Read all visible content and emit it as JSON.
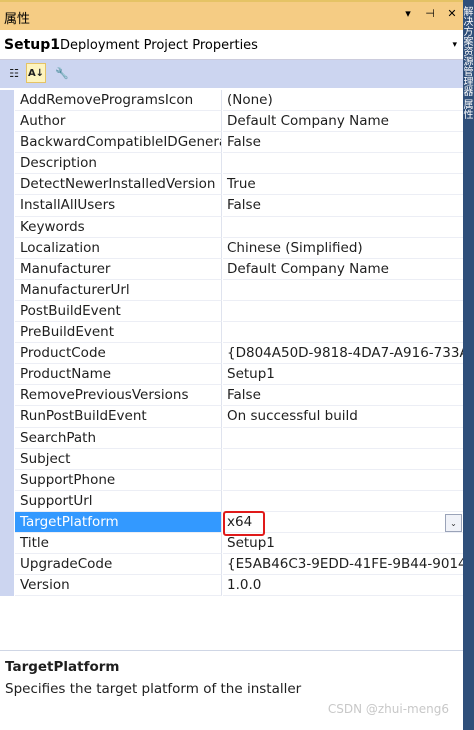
{
  "window": {
    "title": "属性",
    "dropdown_glyph": "▾",
    "pin_glyph": "⊣",
    "close_glyph": "✕"
  },
  "object_selector": {
    "name": "Setup1",
    "type": "Deployment Project Properties",
    "dropdown_glyph": "▾"
  },
  "toolbar": {
    "categorized_glyph": "☷",
    "alphabetical_glyph": "A↓",
    "property_pages_glyph": "🔧"
  },
  "properties": [
    {
      "name": "AddRemoveProgramsIcon",
      "value": "(None)"
    },
    {
      "name": "Author",
      "value": "Default Company Name"
    },
    {
      "name": "BackwardCompatibleIDGenera",
      "value": "False"
    },
    {
      "name": "Description",
      "value": ""
    },
    {
      "name": "DetectNewerInstalledVersion",
      "value": "True"
    },
    {
      "name": "InstallAllUsers",
      "value": "False"
    },
    {
      "name": "Keywords",
      "value": ""
    },
    {
      "name": "Localization",
      "value": "Chinese (Simplified)"
    },
    {
      "name": "Manufacturer",
      "value": "Default Company Name"
    },
    {
      "name": "ManufacturerUrl",
      "value": ""
    },
    {
      "name": "PostBuildEvent",
      "value": ""
    },
    {
      "name": "PreBuildEvent",
      "value": ""
    },
    {
      "name": "ProductCode",
      "value": "{D804A50D-9818-4DA7-A916-733A"
    },
    {
      "name": "ProductName",
      "value": "Setup1"
    },
    {
      "name": "RemovePreviousVersions",
      "value": "False"
    },
    {
      "name": "RunPostBuildEvent",
      "value": "On successful build"
    },
    {
      "name": "SearchPath",
      "value": ""
    },
    {
      "name": "Subject",
      "value": ""
    },
    {
      "name": "SupportPhone",
      "value": ""
    },
    {
      "name": "SupportUrl",
      "value": ""
    },
    {
      "name": "TargetPlatform",
      "value": "x64"
    },
    {
      "name": "Title",
      "value": "Setup1"
    },
    {
      "name": "UpgradeCode",
      "value": "{E5AB46C3-9EDD-41FE-9B44-90142"
    },
    {
      "name": "Version",
      "value": "1.0.0"
    }
  ],
  "value_dropdown_glyph": "⌄",
  "description": {
    "title": "TargetPlatform",
    "text": "Specifies the target platform of the installer"
  },
  "watermark": "CSDN @zhui-meng6",
  "side_tab": "解决方案资源管理器  属性",
  "colors": {
    "title_bar": "#f5cc84",
    "selected_row": "#3399ff",
    "highlight_box": "#e01a1a",
    "margin": "#ccd5f0"
  }
}
